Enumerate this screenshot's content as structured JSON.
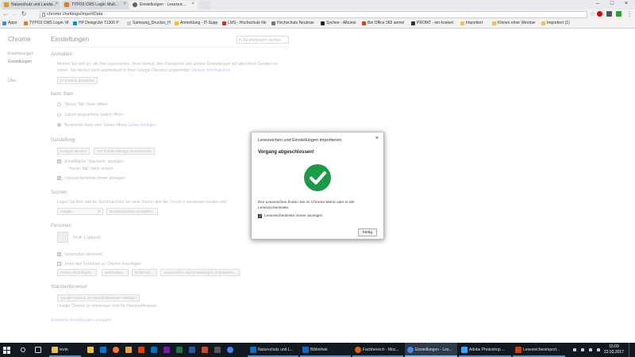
{
  "browser": {
    "tabs": [
      {
        "title": "Naturschutz und Landw...",
        "favicon_color": "#d0a020"
      },
      {
        "title": "TYPO3 CMS Login: Mult...",
        "favicon_color": "#e87b1f"
      },
      {
        "title": "Einstellungen - Lesezeic...",
        "favicon_color": "#5f6368"
      }
    ],
    "url": "chrome://settings/importData",
    "bookmarks": [
      {
        "label": "Apps",
        "color": "#4285f4"
      },
      {
        "label": "TYPO3 CMS Login: M",
        "color": "#e87b1f"
      },
      {
        "label": "HP DesignJet T1300 P",
        "color": "#0096d6"
      },
      {
        "label": "Samsung_Drucker_H",
        "color": "#1428a0"
      },
      {
        "label": "Anmeldung - IT-Supp",
        "color": "#f0c020"
      },
      {
        "label": "LMS - Hochschule Ne",
        "color": "#d03030"
      },
      {
        "label": "Hochschule Neubran",
        "color": "#555555"
      },
      {
        "label": "Sychee - Albums",
        "color": "#222222"
      },
      {
        "label": "Bei Office 365 anmel",
        "color": "#eb3c00"
      },
      {
        "label": "PROMT - ein kostenl",
        "color": "#333333"
      },
      {
        "label": "Importiert",
        "color": "#f0c050"
      },
      {
        "label": "Klonen einer Window",
        "color": "#f0c050"
      },
      {
        "label": "Importiert (1)",
        "color": "#f0c050"
      }
    ]
  },
  "settings": {
    "sidebar_title": "Chrome",
    "sidebar_items": [
      "Erweiterungen",
      "Einstellungen",
      "",
      "Über"
    ],
    "main_title": "Einstellungen",
    "search_placeholder": "In Einstellungen suchen",
    "signin": {
      "heading": "Anmelden",
      "text1": "Melden Sie sich an, um Ihre Lesezeichen, Ihren Verlauf, Ihre Passwörter und andere Einstellungen auf allen Ihren Geräten zu",
      "text2": "sehen. Sie werden auch automatisch in Ihren Google-Diensten angemeldet.",
      "link": "Weitere Informationen",
      "button": "In Chrome anmelden"
    },
    "startup": {
      "heading": "Beim Start",
      "options": [
        "\"Neuer Tab\"-Seite öffnen",
        "Zuletzt angesehene Seiten öffnen",
        "Bestimmte Seite oder Seiten öffnen"
      ],
      "link": "Seiten festlegen"
    },
    "appearance": {
      "heading": "Darstellung",
      "buttons": [
        "Designs abrufen",
        "Auf Standarddesign zurücksetzen"
      ],
      "home_check": "Schaltfläche \"Startseite\" anzeigen",
      "home_sub": "\"Neuer Tab\"-Seite ändern",
      "bookmarks_check": "Lesezeichenleiste immer anzeigen"
    },
    "search": {
      "heading": "Suchen",
      "text": "Legen Sie fest, welche Suchmaschine bei einer Suche über die",
      "link": "Omnibox",
      "text_end": "verwendet werden soll.",
      "engine": "Google",
      "manage": "Suchmaschinen verwalten..."
    },
    "people": {
      "heading": "Personen",
      "profile": "Profil 1 (aktuell)",
      "guest": "Gastmodus aktivieren",
      "anyone": "Jeder darf Personen zu Chrome hinzufügen",
      "buttons": [
        "Person hinzufügen...",
        "Bearbeiten...",
        "Entfernen...",
        "Lesezeichen und Einstellungen importieren..."
      ]
    },
    "default_browser": {
      "heading": "Standardbrowser",
      "button": "Google Chrome als Standardbrowser festlegen",
      "text": "Google Chrome ist momentan nicht Ihr Standardbrowser."
    },
    "advanced_link": "Erweiterte Einstellungen anzeigen"
  },
  "dialog": {
    "title": "Lesezeichen und Einstellungen importieren",
    "heading": "Vorgang abgeschlossen!",
    "message": "Ihre Lesezeichen finden Sie im Chrome-Menü oder in der Lesezeichenleiste.",
    "checkbox_label": "Lesezeichenleiste immer anzeigen",
    "done_button": "Fertig",
    "success_color": "#1a9c47"
  },
  "taskbar": {
    "items": [
      {
        "label": "texte",
        "color": "#f0c040"
      },
      {
        "label": "Naturschutz und L...",
        "color": "#0a6bc8"
      },
      {
        "label": "Bibliothek",
        "color": "#0a6bc8"
      },
      {
        "label": "Fachbereich - Moz...",
        "color": "#e66000"
      },
      {
        "label": "Einstellungen - Les...",
        "color": "#4285f4"
      },
      {
        "label": "Adobe Photoshop ...",
        "color": "#31a8ff"
      },
      {
        "label": "Lesezeichenimport...",
        "color": "#d83b01"
      }
    ],
    "time": "15:09",
    "date": "22.03.2017"
  }
}
